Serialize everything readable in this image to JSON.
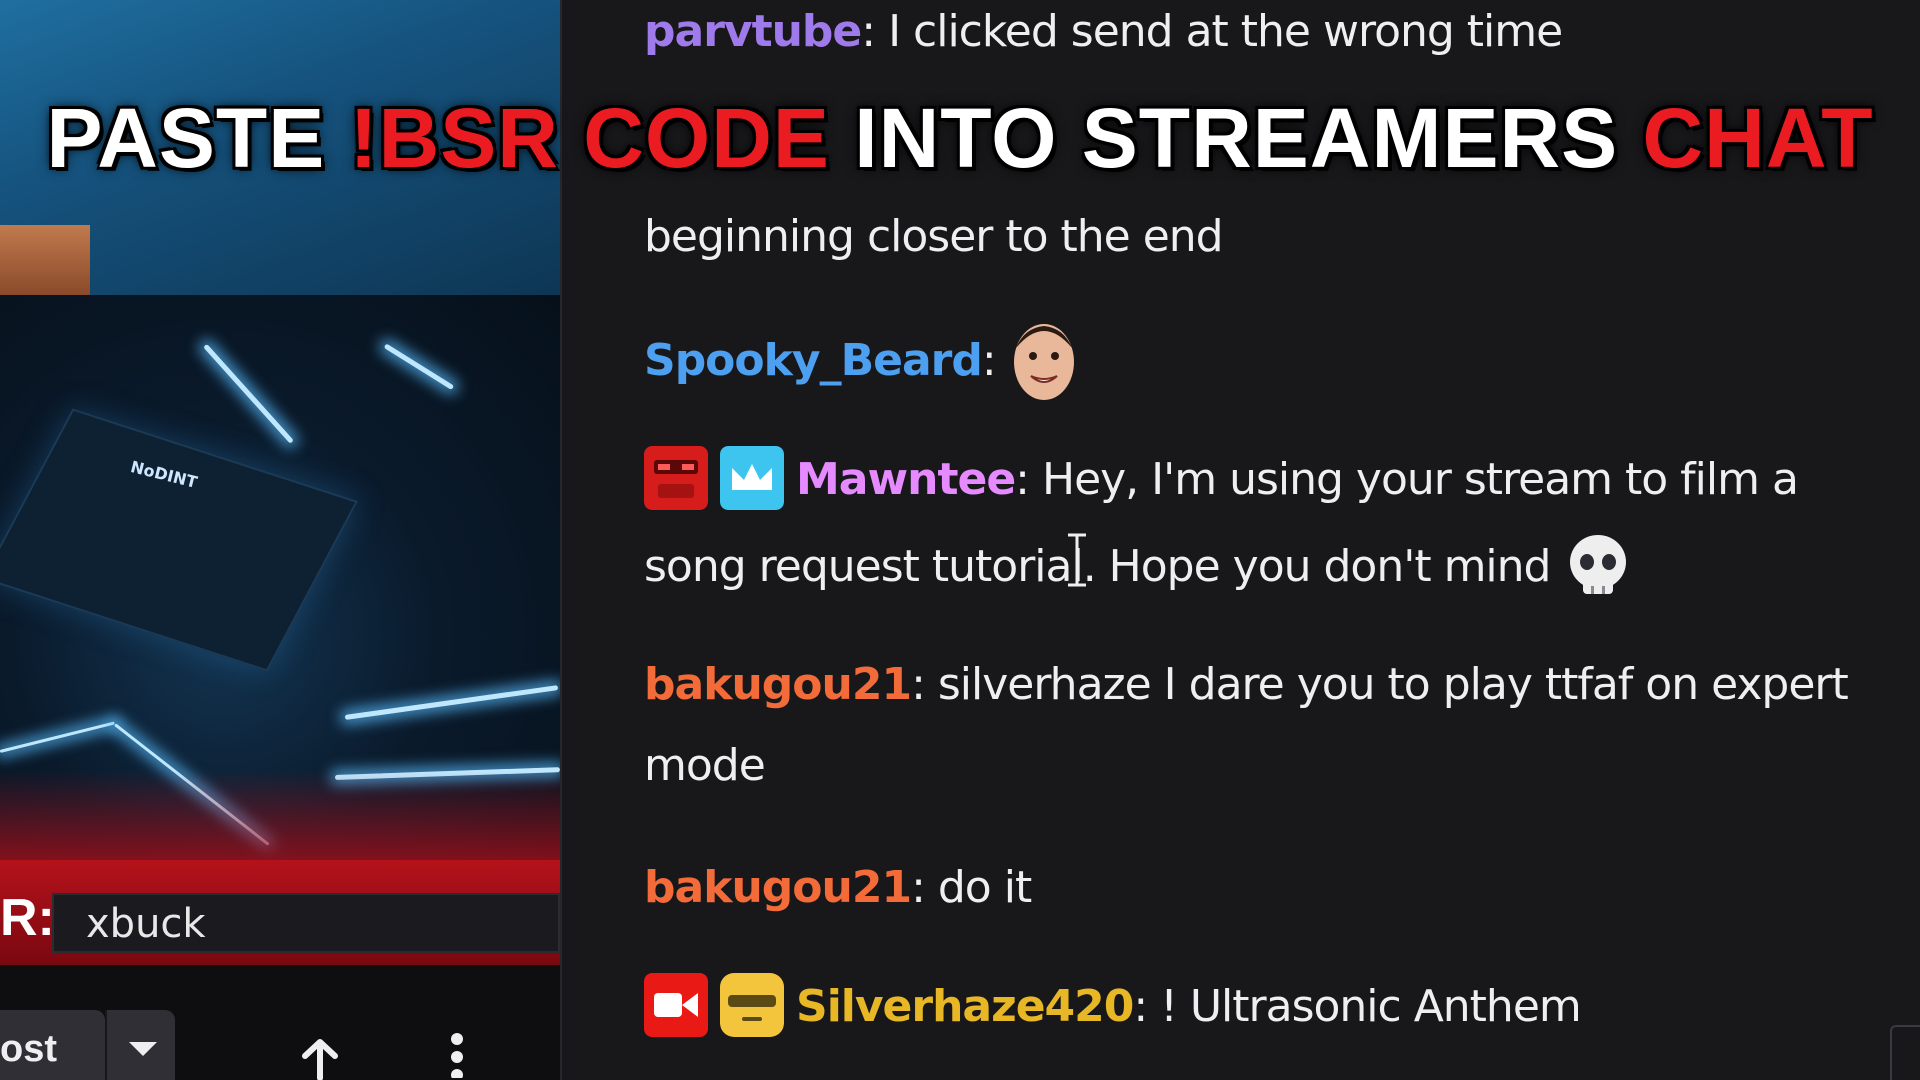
{
  "overlay": {
    "part1": "PASTE ",
    "part2": "!BSR CODE",
    "part3": " INTO STREAMERS ",
    "part4": "CHAT",
    "accent_color": "#ea1c22"
  },
  "stream": {
    "request_label": "R:",
    "request_value": "xbuck",
    "block_text": "NoDINT",
    "boost_label": "ost",
    "icons": [
      "chevron-down-icon",
      "share-icon",
      "more-vertical-icon"
    ]
  },
  "chat": {
    "messages": [
      {
        "user": "parvtube",
        "color": "#9f7aea",
        "text": " I clicked send at the wrong time"
      },
      {
        "text": "beginning closer to the end"
      },
      {
        "user": "Spooky_Beard",
        "color": "#4d9ff0",
        "text": "",
        "emote": "face-emote"
      },
      {
        "user": "Mawntee",
        "color": "#e58bff",
        "badges": [
          "red-robot-badge",
          "crown-badge"
        ],
        "text": " Hey, I'm using your stream to film a",
        "continuation": "song request tutorial. Hope you don't mind",
        "emote": "skull-emote"
      },
      {
        "user": "bakugou21",
        "color": "#f26b38",
        "text": " silverhaze I dare you to play ttfaf on expert",
        "continuation": "mode"
      },
      {
        "user": "bakugou21",
        "color": "#f26b38",
        "text": " do it"
      },
      {
        "user": "Silverhaze420",
        "color": "#e8b725",
        "badges": [
          "broadcaster-badge",
          "sunglasses-badge"
        ],
        "text": " ! Ultrasonic Anthem"
      }
    ],
    "separator": ":"
  }
}
